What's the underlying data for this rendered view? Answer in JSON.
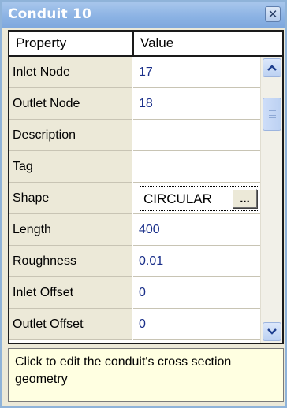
{
  "window": {
    "title": "Conduit 10",
    "close_icon": "close-icon"
  },
  "grid": {
    "headers": {
      "property": "Property",
      "value": "Value"
    },
    "rows": [
      {
        "property": "Inlet Node",
        "value": "17"
      },
      {
        "property": "Outlet Node",
        "value": "18"
      },
      {
        "property": "Description",
        "value": ""
      },
      {
        "property": "Tag",
        "value": ""
      },
      {
        "property": "Shape",
        "value": "CIRCULAR",
        "editor_button": "..."
      },
      {
        "property": "Length",
        "value": "400"
      },
      {
        "property": "Roughness",
        "value": "0.01"
      },
      {
        "property": "Inlet Offset",
        "value": "0"
      },
      {
        "property": "Outlet Offset",
        "value": "0"
      }
    ]
  },
  "description_panel": {
    "text": "Click to edit the conduit's cross section geometry"
  },
  "colors": {
    "title_bar": "#8cb3e4",
    "property_column": "#ece9d8",
    "value_text": "#1a2f8a",
    "description_bg": "#ffffe1"
  }
}
